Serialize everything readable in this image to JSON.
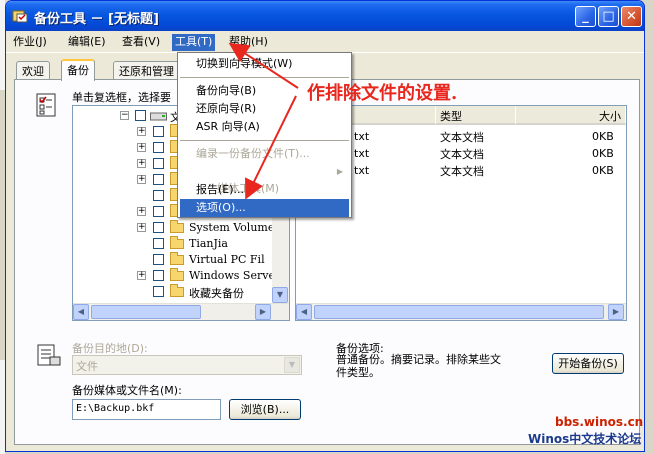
{
  "window": {
    "title": "备份工具 － [无标题]",
    "caption_buttons": {
      "minimize": "_",
      "maximize": "□",
      "close": "✕"
    }
  },
  "menubar": [
    "作业(J)",
    "编辑(E)",
    "查看(V)",
    "工具(T)",
    "帮助(H)"
  ],
  "tabs": [
    "欢迎",
    "备份",
    "还原和管理"
  ],
  "tools_menu": {
    "items": [
      {
        "label": "切换到向导模式(W)",
        "enabled": true
      },
      {
        "label": "备份向导(B)",
        "enabled": true
      },
      {
        "label": "还原向导(R)",
        "enabled": true
      },
      {
        "label": "ASR 向导(A)",
        "enabled": true
      },
      {
        "label": "编录一份备份文件(T)...",
        "enabled": false
      },
      {
        "label": "媒体工具(M)",
        "enabled": false,
        "submenu": true
      },
      {
        "label": "报告(E)...",
        "enabled": true
      },
      {
        "label": "选项(O)...",
        "enabled": true,
        "highlighted": true
      }
    ]
  },
  "backup_panel": {
    "instruction": "单击复选框，选择要",
    "tree_first_label": "文",
    "tree_items": [
      "System Volume",
      "TianJia",
      "Virtual PC Fil",
      "Windows Server",
      "收藏夹备份"
    ],
    "file_columns": [
      "类型",
      "大小"
    ],
    "files": [
      {
        "name": "txt",
        "type": "文本文档",
        "size": "0KB"
      },
      {
        "name": "txt",
        "type": "文本文档",
        "size": "0KB"
      },
      {
        "name": "txt",
        "type": "文本文档",
        "size": "0KB"
      }
    ]
  },
  "destination": {
    "label": "备份目的地(D):",
    "value": "文件"
  },
  "media": {
    "label": "备份媒体或文件名(M):",
    "value": "E:\\Backup.bkf",
    "browse_label": "浏览(B)..."
  },
  "backup_options": {
    "title": "备份选项:",
    "description": "普通备份。摘要记录。排除某些文件类型。"
  },
  "start_button": "开始备份(S)",
  "annotation": "作排除文件的设置.",
  "watermark": {
    "line1": "bbs.winos.cn",
    "line2": "Winos中文技术论坛"
  },
  "colors": {
    "titlebar": "#0857e0",
    "annotation": "#e8271e",
    "highlight": "#316ac5"
  }
}
